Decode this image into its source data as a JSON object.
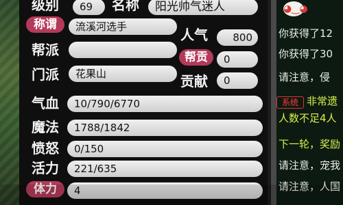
{
  "character_panel": {
    "level_label": "级别",
    "level_value": "69",
    "name_label": "名称",
    "name_value": "阳光帅气迷人",
    "title_button": "称谓",
    "title_value": "流溪河选手",
    "popularity_label": "人气",
    "popularity_value": "800",
    "guild_label": "帮派",
    "guild_value": "",
    "guild_contribution_button": "帮贡",
    "guild_contribution_value": "0",
    "sect_label": "门派",
    "sect_value": "花果山",
    "contribution_label": "贡献",
    "contribution_value": "0",
    "hp_label": "气血",
    "hp_value": "10/790/6770",
    "mp_label": "魔法",
    "mp_value": "1788/1842",
    "rage_label": "愤怒",
    "rage_value": "0/150",
    "vitality_label": "活力",
    "vitality_value": "221/635",
    "stamina_button": "体力",
    "stamina_value": "4"
  },
  "chat": {
    "lines": [
      "你获得了12",
      "你获得了30",
      "请注意，侵",
      "非常遗",
      "人数不足4人",
      "下一轮，奖励",
      "请注意，宠我",
      "请注意，人国"
    ],
    "system_tag": "系统"
  },
  "colors": {
    "panel_bg": "#0f0f0f",
    "field_bg": "#e1e1e1",
    "pink_button": "#b43a5a",
    "blue_button": "#3b5ab6",
    "chat_bg": "#0d1a11",
    "chat_highlight": "#d8f04b",
    "system_tag": "#ff3b3b"
  }
}
